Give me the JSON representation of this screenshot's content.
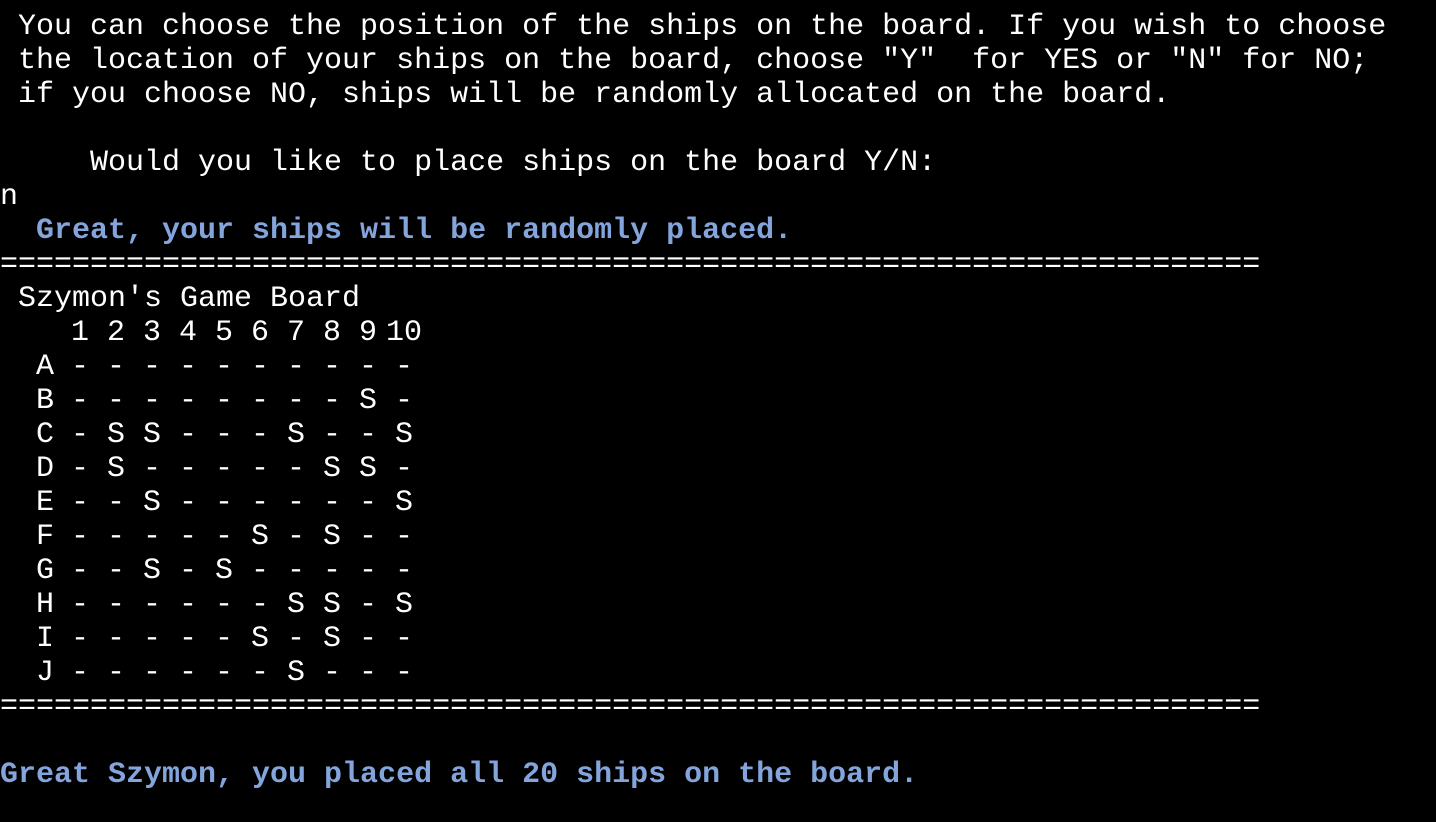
{
  "intro": {
    "line1": " You can choose the position of the ships on the board. If you wish to choose",
    "line2": " the location of your ships on the board, choose \"Y\"  for YES or \"N\" for NO;",
    "line3": " if you choose NO, ships will be randomly allocated on the board."
  },
  "prompt": {
    "question": "     Would you like to place ships on the board Y/N:",
    "user_input": "n"
  },
  "messages": {
    "random_placed": "  Great, your ships will be randomly placed.",
    "all_placed": "Great Szymon, you placed all 20 ships on the board."
  },
  "separator": "======================================================================",
  "board": {
    "title": "Szymon's Game Board",
    "columns": [
      "1",
      "2",
      "3",
      "4",
      "5",
      "6",
      "7",
      "8",
      "9",
      "10"
    ],
    "rows": [
      {
        "label": "A",
        "cells": [
          "-",
          "-",
          "-",
          "-",
          "-",
          "-",
          "-",
          "-",
          "-",
          "-"
        ]
      },
      {
        "label": "B",
        "cells": [
          "-",
          "-",
          "-",
          "-",
          "-",
          "-",
          "-",
          "-",
          "S",
          "-"
        ]
      },
      {
        "label": "C",
        "cells": [
          "-",
          "S",
          "S",
          "-",
          "-",
          "-",
          "S",
          "-",
          "-",
          "S"
        ]
      },
      {
        "label": "D",
        "cells": [
          "-",
          "S",
          "-",
          "-",
          "-",
          "-",
          "-",
          "S",
          "S",
          "-"
        ]
      },
      {
        "label": "E",
        "cells": [
          "-",
          "-",
          "S",
          "-",
          "-",
          "-",
          "-",
          "-",
          "-",
          "S"
        ]
      },
      {
        "label": "F",
        "cells": [
          "-",
          "-",
          "-",
          "-",
          "-",
          "S",
          "-",
          "S",
          "-",
          "-"
        ]
      },
      {
        "label": "G",
        "cells": [
          "-",
          "-",
          "S",
          "-",
          "S",
          "-",
          "-",
          "-",
          "-",
          "-"
        ]
      },
      {
        "label": "H",
        "cells": [
          "-",
          "-",
          "-",
          "-",
          "-",
          "-",
          "S",
          "S",
          "-",
          "S"
        ]
      },
      {
        "label": "I",
        "cells": [
          "-",
          "-",
          "-",
          "-",
          "-",
          "S",
          "-",
          "S",
          "-",
          "-"
        ]
      },
      {
        "label": "J",
        "cells": [
          "-",
          "-",
          "-",
          "-",
          "-",
          "-",
          "S",
          "-",
          "-",
          "-"
        ]
      }
    ]
  }
}
